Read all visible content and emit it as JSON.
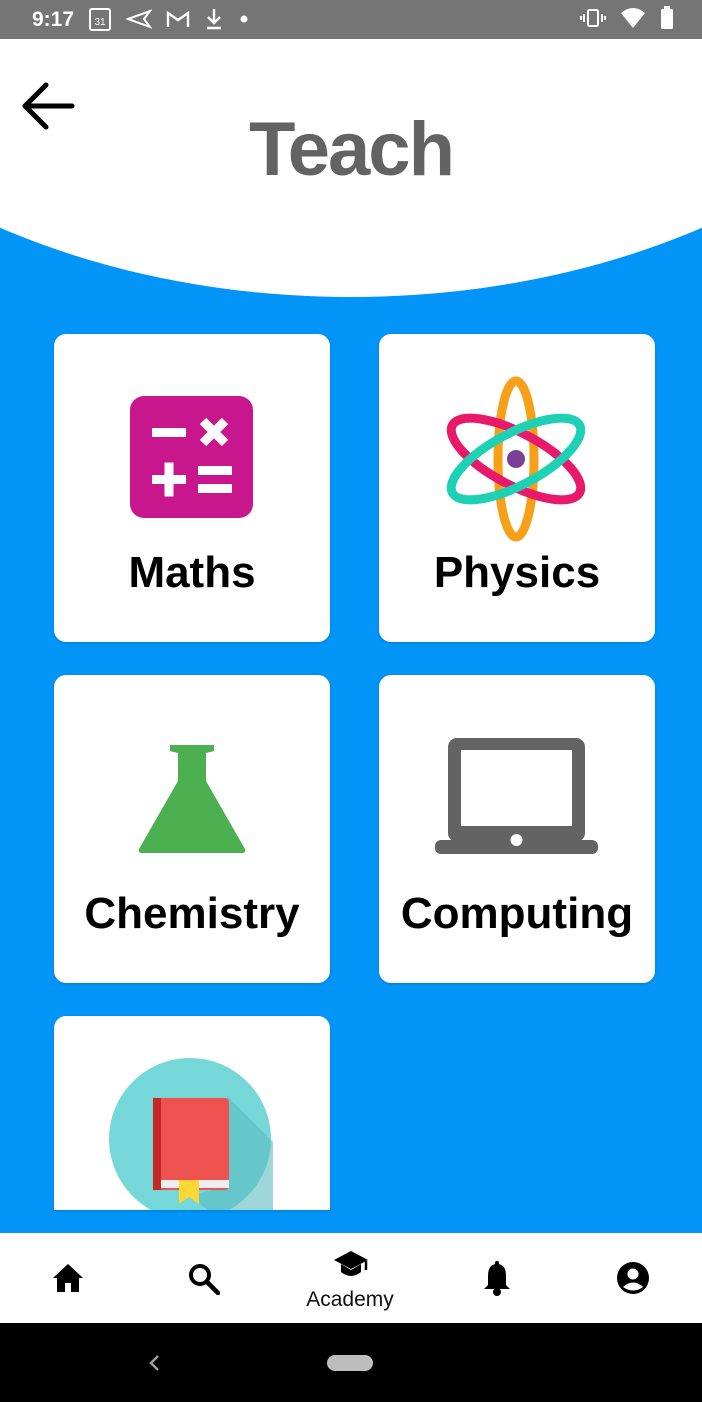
{
  "status_bar": {
    "time": "9:17",
    "left_icons": [
      "calendar-icon",
      "send-icon",
      "gmail-icon",
      "download-icon",
      "dot-icon"
    ],
    "calendar_day": "31",
    "right_icons": [
      "vibrate-icon",
      "wifi-icon",
      "battery-icon"
    ]
  },
  "header": {
    "title": "Teach",
    "back_icon": "arrow-left-icon"
  },
  "subjects": [
    {
      "label": "Maths",
      "icon": "calculator-icon",
      "color": "#c8178c"
    },
    {
      "label": "Physics",
      "icon": "atom-icon",
      "color": "#1fd1b4"
    },
    {
      "label": "Chemistry",
      "icon": "flask-icon",
      "color": "#4caf50"
    },
    {
      "label": "Computing",
      "icon": "laptop-icon",
      "color": "#636363"
    },
    {
      "label": "",
      "icon": "book-icon",
      "color": "#ef5350"
    }
  ],
  "bottom_nav": {
    "items": [
      {
        "name": "home",
        "icon": "home-icon",
        "label": ""
      },
      {
        "name": "search",
        "icon": "search-icon",
        "label": ""
      },
      {
        "name": "academy",
        "icon": "graduation-cap-icon",
        "label": "Academy"
      },
      {
        "name": "notifications",
        "icon": "bell-icon",
        "label": ""
      },
      {
        "name": "profile",
        "icon": "account-circle-icon",
        "label": ""
      }
    ]
  },
  "colors": {
    "background": "#0295f7",
    "title": "#636363"
  }
}
